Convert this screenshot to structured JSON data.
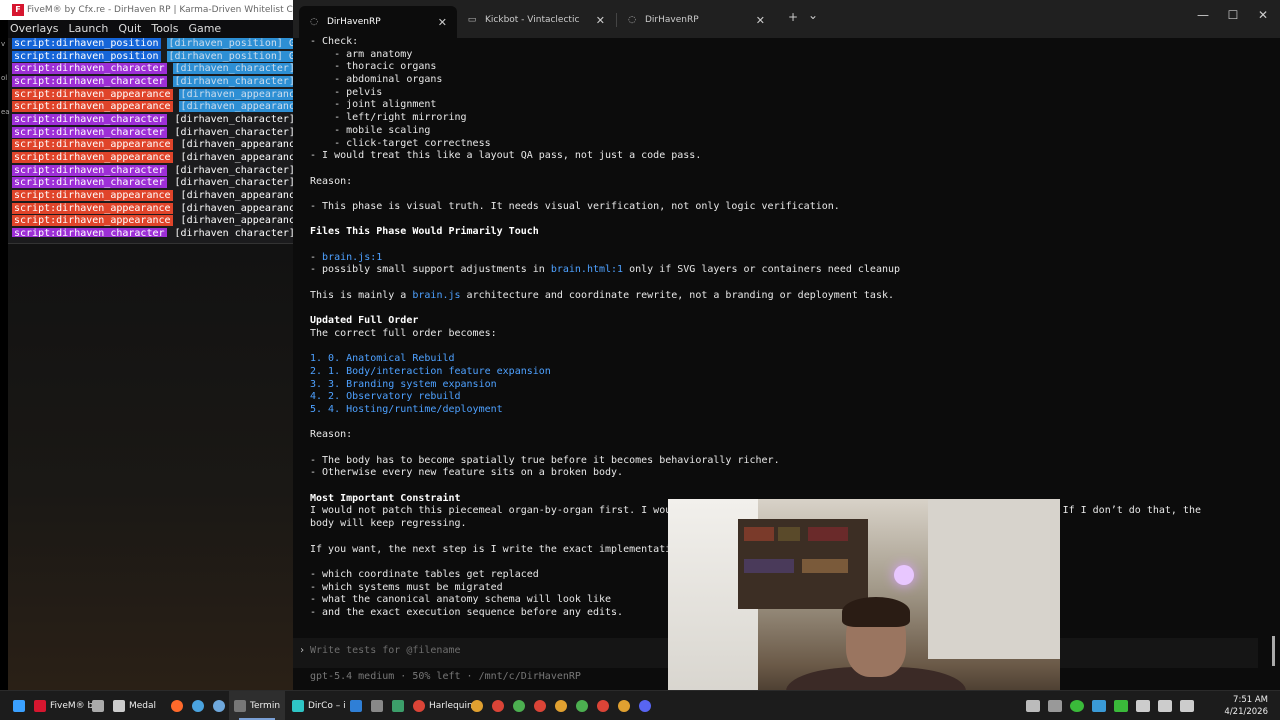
{
  "fivem": {
    "title": "FiveM® by Cfx.re - DirHaven RP | Karma-Driven Whitelist City",
    "logo": "F",
    "menu": [
      "Overlays",
      "Launch",
      "Quit",
      "Tools",
      "Game"
    ],
    "log": [
      {
        "tag": "script:dirhaven_position",
        "kind": "position",
        "msg": "[dirhaven_position] G",
        "hl": true
      },
      {
        "tag": "script:dirhaven_position",
        "kind": "position",
        "msg": "[dirhaven_position] G",
        "hl": true
      },
      {
        "tag": "script:dirhaven_character",
        "kind": "character",
        "msg": "[dirhaven_character]",
        "hl": true
      },
      {
        "tag": "script:dirhaven_character",
        "kind": "character",
        "msg": "[dirhaven_character]",
        "hl": true
      },
      {
        "tag": "script:dirhaven_appearance",
        "kind": "appearance",
        "msg": "[dirhaven_appearance",
        "hl": true
      },
      {
        "tag": "script:dirhaven_appearance",
        "kind": "appearance",
        "msg": "[dirhaven_appearance",
        "hl": true
      },
      {
        "tag": "script:dirhaven_character",
        "kind": "character",
        "msg": "[dirhaven_character]",
        "hl": false
      },
      {
        "tag": "script:dirhaven_character",
        "kind": "character",
        "msg": "[dirhaven_character]",
        "hl": false
      },
      {
        "tag": "script:dirhaven_appearance",
        "kind": "appearance",
        "msg": "[dirhaven_appearance",
        "hl": false
      },
      {
        "tag": "script:dirhaven_appearance",
        "kind": "appearance",
        "msg": "[dirhaven_appearance",
        "hl": false
      },
      {
        "tag": "script:dirhaven_character",
        "kind": "character",
        "msg": "[dirhaven_character]",
        "hl": false
      },
      {
        "tag": "script:dirhaven_character",
        "kind": "character",
        "msg": "[dirhaven_character]",
        "hl": false
      },
      {
        "tag": "script:dirhaven_appearance",
        "kind": "appearance",
        "msg": "[dirhaven_appearance",
        "hl": false
      },
      {
        "tag": "script:dirhaven_appearance",
        "kind": "appearance",
        "msg": "[dirhaven_appearance",
        "hl": false
      },
      {
        "tag": "script:dirhaven_appearance",
        "kind": "appearance",
        "msg": "[dirhaven_appearance",
        "hl": false
      },
      {
        "tag": "script:dirhaven_character",
        "kind": "character",
        "msg": "[dirhaven_character]",
        "hl": false
      }
    ],
    "side_labels": [
      "v",
      "ol",
      "ea"
    ]
  },
  "browser": {
    "tabs": [
      {
        "label": "DirHavenRP",
        "icon": "spinner-icon",
        "active": true
      },
      {
        "label": "Kickbot - Vintaclectic",
        "icon": "page-icon",
        "active": false
      },
      {
        "label": "DirHavenRP",
        "icon": "spinner-icon",
        "active": false
      }
    ],
    "tab_close": "✕",
    "new_tab": "+",
    "tab_menu": "⌄",
    "window_buttons": {
      "minimize": "—",
      "maximize": "☐",
      "close": "✕"
    }
  },
  "terminal": {
    "lines": [
      [
        {
          "t": "- Check:"
        }
      ],
      [
        {
          "t": "    - arm anatomy"
        }
      ],
      [
        {
          "t": "    - thoracic organs"
        }
      ],
      [
        {
          "t": "    - abdominal organs"
        }
      ],
      [
        {
          "t": "    - pelvis"
        }
      ],
      [
        {
          "t": "    - joint alignment"
        }
      ],
      [
        {
          "t": "    - left/right mirroring"
        }
      ],
      [
        {
          "t": "    - mobile scaling"
        }
      ],
      [
        {
          "t": "    - click-target correctness"
        }
      ],
      [
        {
          "t": "- I would treat this like a layout QA pass, not just a code pass."
        }
      ],
      [],
      [
        {
          "t": "Reason:"
        }
      ],
      [],
      [
        {
          "t": "- This phase is visual truth. It needs visual verification, not only logic verification."
        }
      ],
      [],
      [
        {
          "t": "Files This Phase Would Primarily Touch",
          "s": "b"
        }
      ],
      [],
      [
        {
          "t": "- "
        },
        {
          "t": "brain.js:1",
          "s": "lnk"
        }
      ],
      [
        {
          "t": "- possibly small support adjustments in "
        },
        {
          "t": "brain.html:1",
          "s": "lnk"
        },
        {
          "t": " only if SVG layers or containers need cleanup"
        }
      ],
      [],
      [
        {
          "t": "This is mainly a "
        },
        {
          "t": "brain.js",
          "s": "lnk"
        },
        {
          "t": " architecture and coordinate rewrite, not a branding or deployment task."
        }
      ],
      [],
      [
        {
          "t": "Updated Full Order",
          "s": "b"
        }
      ],
      [
        {
          "t": "The correct full order becomes:"
        }
      ],
      [],
      [
        {
          "t": "1. 0. Anatomical Rebuild",
          "s": "lnk"
        }
      ],
      [
        {
          "t": "2. 1. Body/interaction feature expansion",
          "s": "lnk"
        }
      ],
      [
        {
          "t": "3. 3. Branding system expansion",
          "s": "lnk"
        }
      ],
      [
        {
          "t": "4. 2. Observatory rebuild",
          "s": "lnk"
        }
      ],
      [
        {
          "t": "5. 4. Hosting/runtime/deployment",
          "s": "lnk"
        }
      ],
      [],
      [
        {
          "t": "Reason:"
        }
      ],
      [],
      [
        {
          "t": "- The body has to become spatially true before it becomes behaviorally richer."
        }
      ],
      [
        {
          "t": "- Otherwise every new feature sits on a broken body."
        }
      ],
      [],
      [
        {
          "t": "Most Important Constraint",
          "s": "b"
        }
      ],
      [
        {
          "t": "I would not patch this piecemeal organ-by-organ first. I wou                                                         nto it. If I don’t do that, the"
        }
      ],
      [
        {
          "t": "body will keep regressing."
        }
      ],
      [],
      [
        {
          "t": "If you want, the next step is I write the exact implementati"
        }
      ],
      [],
      [
        {
          "t": "- which coordinate tables get replaced"
        }
      ],
      [
        {
          "t": "- which systems must be migrated"
        }
      ],
      [
        {
          "t": "- what the canonical anatomy schema will look like"
        }
      ],
      [
        {
          "t": "- and the exact execution sequence before any edits."
        }
      ]
    ],
    "prompt_symbol": "›",
    "input_placeholder": "Write tests for @filename",
    "status": "gpt-5.4 medium · 50% left · /mnt/c/DirHavenRP"
  },
  "taskbar": {
    "items": [
      {
        "label": "",
        "icon": "windows-start-icon",
        "color": "#3aa0ff"
      },
      {
        "label": "FiveM® by",
        "icon": "fivem-icon",
        "color": "#d6162f"
      },
      {
        "label": "",
        "icon": "settings-icon",
        "color": "#aaaaaa"
      },
      {
        "label": "Medal",
        "icon": "medal-icon",
        "color": "#cccccc"
      },
      {
        "label": "",
        "icon": "firefox-icon",
        "color": "#ff6a2b"
      },
      {
        "label": "",
        "icon": "chrome-icon",
        "color": "#4aa3df"
      },
      {
        "label": "",
        "icon": "steam-icon",
        "color": "#6ea8dc"
      },
      {
        "label": "Termin",
        "icon": "terminal-icon",
        "color": "#777777",
        "active": true
      },
      {
        "label": "DirCo – i",
        "icon": "edge-icon",
        "color": "#2ec4c4"
      },
      {
        "label": "",
        "icon": "vscode-icon",
        "color": "#2f7fd6"
      },
      {
        "label": "",
        "icon": "app-icon",
        "color": "#888888"
      },
      {
        "label": "",
        "icon": "app-icon",
        "color": "#3c9e6a"
      },
      {
        "label": "Harlequin (",
        "icon": "chrome-icon",
        "color": "#db4437"
      },
      {
        "label": "",
        "icon": "chrome-icon",
        "color": "#e0a030"
      },
      {
        "label": "",
        "icon": "chrome-icon",
        "color": "#db4437"
      },
      {
        "label": "",
        "icon": "chrome-icon",
        "color": "#4caf50"
      },
      {
        "label": "",
        "icon": "chrome-icon",
        "color": "#db4437"
      },
      {
        "label": "",
        "icon": "chrome-icon",
        "color": "#e0a030"
      },
      {
        "label": "",
        "icon": "chrome-icon",
        "color": "#4caf50"
      },
      {
        "label": "",
        "icon": "chrome-icon",
        "color": "#db4437"
      },
      {
        "label": "",
        "icon": "chrome-icon",
        "color": "#e0a030"
      },
      {
        "label": "",
        "icon": "discord-icon",
        "color": "#5865f2"
      }
    ],
    "clock_time": "7:51 AM",
    "clock_date": "4/21/2026"
  }
}
